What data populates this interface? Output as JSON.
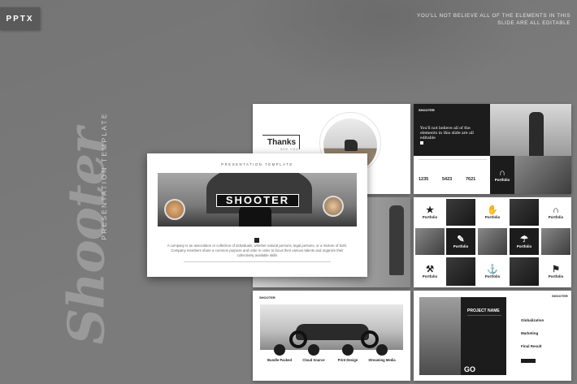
{
  "badge": "PPTX",
  "tagline": "YOU'LL NOT BELIEVE ALL OF THE ELEMENTS IN THIS SLIDE ARE ALL EDITABLE",
  "script_title": "Shooter",
  "vertical_subtitle": "PRESENTATION TEMPLATE",
  "cover": {
    "kicker": "PRESENTATION TEMPLATE",
    "title": "SHOOTER",
    "body_1": "A company is an association or collection of individuals, whether natural persons, legal persons, or a mixture of both.",
    "body_2": "Company members share a common purpose and unite in order to focus their various talents and organize their collectively available skills"
  },
  "thanks": {
    "title": "Thanks",
    "sub": "SEE YOU"
  },
  "stats": {
    "logo": "SHOOTER",
    "headline": "You'll not believe all of the elements in this slide are all editable",
    "n1": "1235",
    "n2": "5423",
    "n3": "7621",
    "tile_label": "Portfolio"
  },
  "portfolio_label": "Portfolio",
  "services": {
    "logo": "SHOOTER",
    "items": [
      "Bundle Packed",
      "Cloud Source",
      "Print Design",
      "Streaming Media"
    ]
  },
  "project": {
    "logo": "SHOOTER",
    "title": "PROJECT NAME",
    "go": "GO",
    "list": [
      "Globalization",
      "Marketing",
      "Final Result"
    ]
  },
  "colors": {
    "background": "#7b7b7b",
    "dark": "#1c1c1c",
    "accent": "#ffffff"
  }
}
